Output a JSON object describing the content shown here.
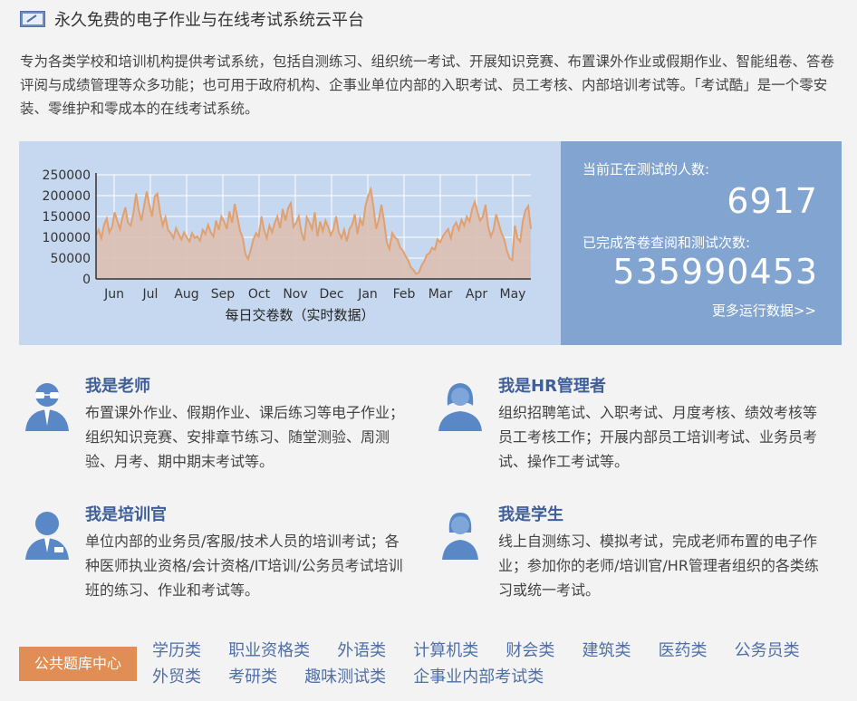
{
  "header": {
    "title": "永久免费的电子作业与在线考试系统云平台",
    "icon": "pencil-note-icon"
  },
  "intro": "专为各类学校和培训机构提供考试系统，包括自测练习、组织统一考试、开展知识竞赛、布置课外作业或假期作业、智能组卷、答卷评阅与成绩管理等众多功能；也可用于政府机构、企事业单位内部的入职考试、员工考核、内部培训考试等。「考试酷」是一个零安装、零维护和零成本的在线考试系统。",
  "stats": {
    "current_label": "当前正在测试的人数:",
    "current_value": "6917",
    "total_label": "已完成答卷查阅和测试次数:",
    "total_value": "535990453",
    "more_link": "更多运行数据>>"
  },
  "chart_data": {
    "type": "area",
    "xlabel": "每日交卷数（实时数据）",
    "ylabel": "",
    "ylim": [
      0,
      250000
    ],
    "y_ticks": [
      "0",
      "50000",
      "100000",
      "150000",
      "200000",
      "250000"
    ],
    "x_ticks": [
      "Jun",
      "Jul",
      "Aug",
      "Sep",
      "Oct",
      "Nov",
      "Dec",
      "Jan",
      "Feb",
      "Mar",
      "Apr",
      "May"
    ],
    "grid": true,
    "colors": {
      "line": "#e0a070",
      "fill": "#dcc0b2",
      "background": "#c6d8ef"
    },
    "series": [
      {
        "values": [
          105000,
          118000,
          98000,
          130000,
          145000,
          112000,
          125000,
          160000,
          138000,
          120000,
          150000,
          172000,
          135000,
          128000,
          158000,
          205000,
          165000,
          140000,
          175000,
          210000,
          178000,
          150000,
          198000,
          205000,
          160000,
          128000,
          148000,
          118000,
          110000,
          98000,
          122000,
          108000,
          95000,
          112000,
          100000,
          90000,
          110000,
          98000,
          102000,
          92000,
          118000,
          108000,
          130000,
          112000,
          102000,
          140000,
          118000,
          150000,
          138000,
          120000,
          162000,
          135000,
          180000,
          148000,
          115000,
          98000,
          60000,
          48000,
          70000,
          95000,
          110000,
          102000,
          150000,
          118000,
          98000,
          128000,
          112000,
          135000,
          150000,
          122000,
          168000,
          140000,
          170000,
          182000,
          125000,
          135000,
          150000,
          112000,
          92000,
          148000,
          135000,
          120000,
          160000,
          102000,
          138000,
          115000,
          140000,
          125000,
          105000,
          120000,
          150000,
          112000,
          98000,
          118000,
          90000,
          120000,
          130000,
          155000,
          108000,
          145000,
          128000,
          175000,
          200000,
          215000,
          172000,
          120000,
          142000,
          178000,
          138000,
          88000,
          72000,
          110000,
          100000,
          95000,
          75000,
          68000,
          55000,
          45000,
          28000,
          22000,
          12000,
          15000,
          32000,
          42000,
          58000,
          62000,
          75000,
          70000,
          95000,
          88000,
          102000,
          112000,
          120000,
          98000,
          125000,
          135000,
          118000,
          142000,
          128000,
          150000,
          138000,
          168000,
          185000,
          160000,
          140000,
          150000,
          178000,
          125000,
          102000,
          118000,
          155000,
          132000,
          110000,
          95000,
          68000,
          50000,
          45000,
          128000,
          98000,
          90000,
          140000,
          165000,
          175000,
          120000
        ]
      }
    ]
  },
  "roles": [
    {
      "name": "我是老师",
      "desc": "布置课外作业、假期作业、课后练习等电子作业；组织知识竞赛、安排章节练习、随堂测验、周测验、月考、期中期末考试等。",
      "icon": "teacher-icon"
    },
    {
      "name": "我是HR管理者",
      "desc": "组织招聘笔试、入职考试、月度考核、绩效考核等员工考核工作；开展内部员工培训考试、业务员考试、操作工考试等。",
      "icon": "hr-manager-icon"
    },
    {
      "name": "我是培训官",
      "desc": "单位内部的业务员/客服/技术人员的培训考试；各种医师执业资格/会计资格/IT培训/公务员考试培训班的练习、作业和考试等。",
      "icon": "trainer-icon"
    },
    {
      "name": "我是学生",
      "desc": "线上自测练习、模拟考试，完成老师布置的电子作业；参加你的老师/培训官/HR管理者组织的各类练习或统一考试。",
      "icon": "student-icon"
    }
  ],
  "categories": {
    "center_label": "公共题库中心",
    "items": [
      "学历类",
      "职业资格类",
      "外语类",
      "计算机类",
      "财会类",
      "建筑类",
      "医药类",
      "公务员类",
      "外贸类",
      "考研类",
      "趣味测试类",
      "企事业内部考试类"
    ]
  }
}
